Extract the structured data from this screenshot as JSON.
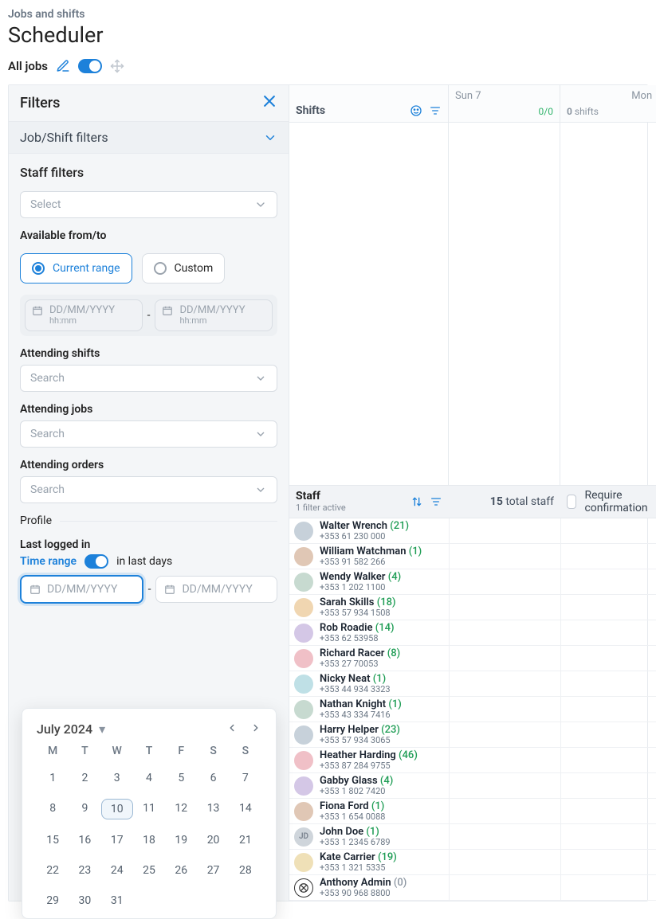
{
  "breadcrumb": "Jobs and shifts",
  "title": "Scheduler",
  "toolbar": {
    "all_jobs": "All jobs"
  },
  "filters": {
    "header": "Filters",
    "job_shift": "Job/Shift filters",
    "staff_filters": "Staff filters",
    "select_placeholder": "Select",
    "available_label": "Available from/to",
    "current_range": "Current range",
    "custom": "Custom",
    "date_ph": "DD/MM/YYYY",
    "time_ph": "hh:mm",
    "attending_shifts": "Attending shifts",
    "attending_jobs": "Attending jobs",
    "attending_orders": "Attending orders",
    "search_ph": "Search",
    "profile": "Profile",
    "last_logged": "Last logged in",
    "time_range": "Time range",
    "in_last_days": "in last days"
  },
  "calendar": {
    "month": "July 2024",
    "dow": [
      "M",
      "T",
      "W",
      "T",
      "F",
      "S",
      "S"
    ],
    "days": [
      "1",
      "2",
      "3",
      "4",
      "5",
      "6",
      "7",
      "8",
      "9",
      "10",
      "11",
      "12",
      "13",
      "14",
      "15",
      "16",
      "17",
      "18",
      "19",
      "20",
      "21",
      "22",
      "23",
      "24",
      "25",
      "26",
      "27",
      "28",
      "29",
      "30",
      "31"
    ],
    "today": "10"
  },
  "grid": {
    "shifts_label": "Shifts",
    "sun": "Sun 7",
    "ratio": "0/0",
    "mon": "Mon",
    "shifts_small": "shifts",
    "zero": "0"
  },
  "staff_header": {
    "title": "Staff",
    "filter_active": "1 filter active",
    "total_num": "15",
    "total_txt": "total staff",
    "require": "Require confirmation"
  },
  "staff": [
    {
      "name": "Walter Wrench",
      "count": "21",
      "cc": "green",
      "phone": "+353 61 230 000",
      "avatar": "t0"
    },
    {
      "name": "William Watchman",
      "count": "1",
      "cc": "green",
      "phone": "+353 91 582 266",
      "avatar": "t1"
    },
    {
      "name": "Wendy Walker",
      "count": "4",
      "cc": "green",
      "phone": "+353 1 202 1100",
      "avatar": "t2"
    },
    {
      "name": "Sarah Skills",
      "count": "18",
      "cc": "green",
      "phone": "+353 57 934 1508",
      "avatar": "t3"
    },
    {
      "name": "Rob Roadie",
      "count": "14",
      "cc": "green",
      "phone": "+353 62 53958",
      "avatar": "t4"
    },
    {
      "name": "Richard Racer",
      "count": "8",
      "cc": "green",
      "phone": "+353 27 70053",
      "avatar": "t5"
    },
    {
      "name": "Nicky Neat",
      "count": "1",
      "cc": "green",
      "phone": "+353 44 934 3323",
      "avatar": "t6"
    },
    {
      "name": "Nathan Knight",
      "count": "1",
      "cc": "green",
      "phone": "+353 43 334 7416",
      "avatar": "t2"
    },
    {
      "name": "Harry Helper",
      "count": "23",
      "cc": "green",
      "phone": "+353 57 934 3065",
      "avatar": "t0"
    },
    {
      "name": "Heather Harding",
      "count": "46",
      "cc": "green",
      "phone": "+353 87 284 9755",
      "avatar": "t5"
    },
    {
      "name": "Gabby Glass",
      "count": "4",
      "cc": "green",
      "phone": "+353 1 802 7420",
      "avatar": "t4"
    },
    {
      "name": "Fiona Ford",
      "count": "1",
      "cc": "green",
      "phone": "+353 1 654 0088",
      "avatar": "t1"
    },
    {
      "name": "John Doe",
      "count": "1",
      "cc": "green",
      "phone": "+353 1 2345 6789",
      "avatar": "jd",
      "initials": "JD"
    },
    {
      "name": "Kate Carrier",
      "count": "19",
      "cc": "green",
      "phone": "+353 1 321 5335",
      "avatar": "t7"
    },
    {
      "name": "Anthony Admin",
      "count": "0",
      "cc": "gray",
      "phone": "+353 90 968 8800",
      "avatar": "anth"
    }
  ]
}
